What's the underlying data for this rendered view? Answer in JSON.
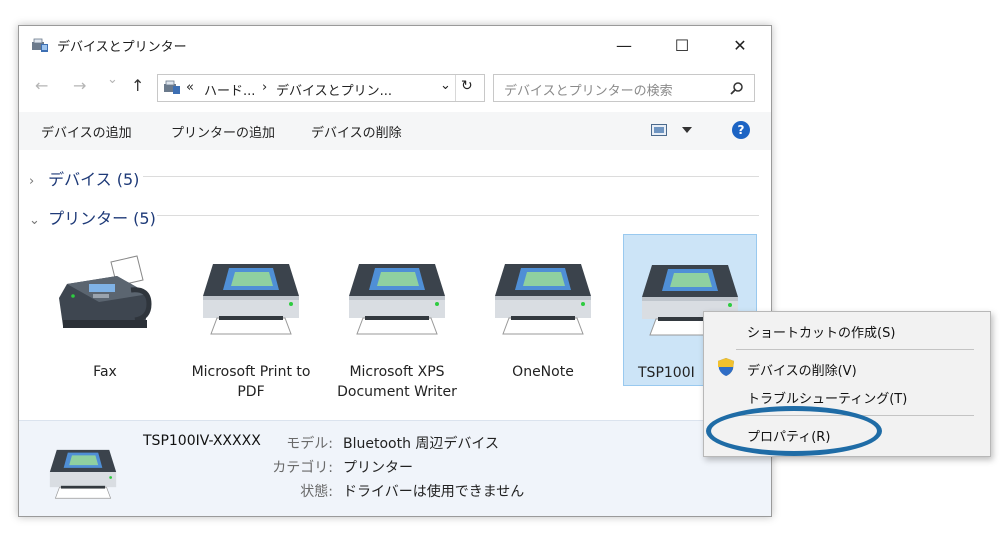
{
  "window": {
    "title": "デバイスとプリンター",
    "minimize_glyph": "—",
    "maximize_glyph": "☐",
    "close_glyph": "✕"
  },
  "address_bar": {
    "back_glyph": "←",
    "forward_glyph": "→",
    "recent_glyph": "⌄",
    "up_glyph": "↑",
    "overflow": "«",
    "crumbs": [
      "ハード...",
      "デバイスとプリン..."
    ],
    "separator": "›",
    "dropdown_glyph": "⌄",
    "refresh_glyph": "↻"
  },
  "search": {
    "placeholder": "デバイスとプリンターの検索",
    "icon": "search-icon"
  },
  "toolbar": {
    "add_device": "デバイスの追加",
    "add_printer": "プリンターの追加",
    "remove_device": "デバイスの削除",
    "help": "?"
  },
  "groups": {
    "devices": {
      "label": "デバイス (5)",
      "collapsed_glyph": "›"
    },
    "printers": {
      "label": "プリンター (5)",
      "expanded_glyph": "⌄"
    }
  },
  "printers": [
    {
      "label": "Fax",
      "icon": "fax-icon"
    },
    {
      "label": "Microsoft Print to PDF",
      "icon": "printer-icon"
    },
    {
      "label": "Microsoft XPS Document Writer",
      "icon": "printer-icon"
    },
    {
      "label": "OneNote",
      "icon": "printer-icon"
    },
    {
      "label": "TSP100IV-XXXXX",
      "label_visible": "TSP100I",
      "icon": "printer-icon",
      "selected": true
    }
  ],
  "details": {
    "name": "TSP100IV-XXXXX",
    "model_key": "モデル:",
    "model_value": "Bluetooth 周辺デバイス",
    "category_key": "カテゴリ:",
    "category_value": "プリンター",
    "status_key": "状態:",
    "status_value": "ドライバーは使用できません"
  },
  "context_menu": {
    "create_shortcut": "ショートカットの作成(S)",
    "remove_device": "デバイスの削除(V)",
    "troubleshoot": "トラブルシューティング(T)",
    "properties": "プロパティ(R)"
  },
  "colors": {
    "highlight_oval": "#1f6ca6",
    "selection": "#cce4f7",
    "group_header": "#1e3a78",
    "help": "#1c64c4"
  }
}
